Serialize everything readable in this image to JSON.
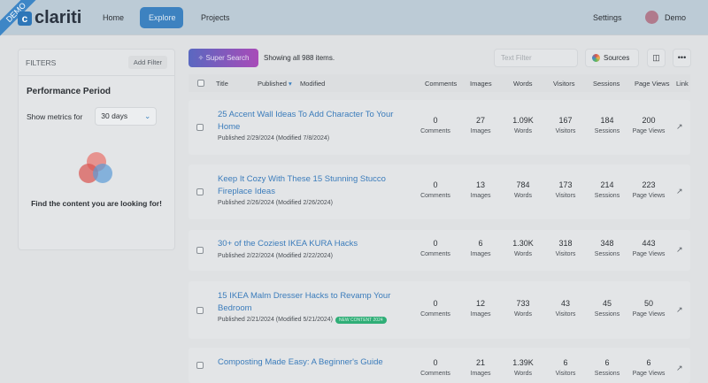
{
  "header": {
    "brand": "clariti",
    "demo_ribbon": "DEMO",
    "nav": [
      "Home",
      "Explore",
      "Projects"
    ],
    "settings": "Settings",
    "user": "Demo"
  },
  "filters": {
    "title": "FILTERS",
    "add_filter": "Add Filter",
    "period_title": "Performance Period",
    "show_metrics_label": "Show metrics for",
    "period_value": "30 days",
    "empty_message": "Find the content you are looking for!"
  },
  "toolbar": {
    "super_search": "Super Search",
    "showing": "Showing all 988 items.",
    "text_filter_placeholder": "Text Filter",
    "sources": "Sources",
    "more": "•••"
  },
  "columns": {
    "title": "Title",
    "published": "Published",
    "modified": "Modified",
    "comments": "Comments",
    "images": "Images",
    "words": "Words",
    "visitors": "Visitors",
    "sessions": "Sessions",
    "page_views": "Page Views",
    "link": "Link"
  },
  "rows": [
    {
      "title": "25 Accent Wall Ideas To Add Character To Your Home",
      "meta": "Published 2/29/2024 (Modified 7/8/2024)",
      "badge": null,
      "comments": "0",
      "images": "27",
      "words": "1.09K",
      "visitors": "167",
      "sessions": "184",
      "page_views": "200"
    },
    {
      "title": "Keep It Cozy With These 15 Stunning Stucco Fireplace Ideas",
      "meta": "Published 2/26/2024 (Modified 2/26/2024)",
      "badge": null,
      "comments": "0",
      "images": "13",
      "words": "784",
      "visitors": "173",
      "sessions": "214",
      "page_views": "223"
    },
    {
      "title": "30+ of the Coziest IKEA KURA Hacks",
      "meta": "Published 2/22/2024 (Modified 2/22/2024)",
      "badge": null,
      "comments": "0",
      "images": "6",
      "words": "1.30K",
      "visitors": "318",
      "sessions": "348",
      "page_views": "443"
    },
    {
      "title": "15 IKEA Malm Dresser Hacks to Revamp Your Bedroom",
      "meta": "Published 2/21/2024 (Modified 5/21/2024)",
      "badge": "NEW CONTENT 2024",
      "comments": "0",
      "images": "12",
      "words": "733",
      "visitors": "43",
      "sessions": "45",
      "page_views": "50"
    },
    {
      "title": "Composting Made Easy: A Beginner's Guide",
      "meta": "",
      "badge": null,
      "comments": "0",
      "images": "21",
      "words": "1.39K",
      "visitors": "6",
      "sessions": "6",
      "page_views": "6"
    }
  ],
  "sublabels": {
    "comments": "Comments",
    "images": "Images",
    "words": "Words",
    "visitors": "Visitors",
    "sessions": "Sessions",
    "page_views": "Page Views"
  }
}
